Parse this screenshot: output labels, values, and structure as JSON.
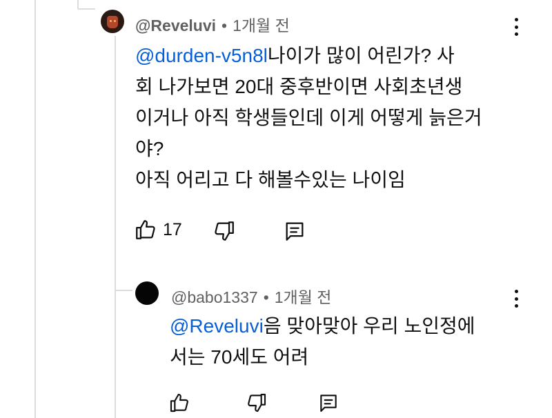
{
  "comment": {
    "author": "@Reveluvi",
    "separator": "•",
    "time": "1개월 전",
    "mention": "@durden-v5n8l",
    "text_line1": "나이가 많이 어린가? 사",
    "text_line2": "회 나가보면 20대 중후반이면 사회초년생",
    "text_line3": "이거나 아직 학생들인데 이게 어떻게 늙은거",
    "text_line4": "야?",
    "text_line5": "아직 어리고 다 해볼수있는 나이임",
    "likes": "17",
    "icons": [
      "thumbs-up-icon",
      "thumbs-down-icon",
      "reply-icon",
      "more-vert-icon"
    ]
  },
  "reply": {
    "author": "@babo1337",
    "separator": "•",
    "time": "1개월 전",
    "mention": "@Reveluvi",
    "text_line1": "음 맞아맞아 우리 노인정에",
    "text_line2": "서는 70세도 어려",
    "icons": [
      "thumbs-up-icon",
      "thumbs-down-icon",
      "reply-icon",
      "more-vert-icon"
    ]
  },
  "colors": {
    "text": "#0f0f0f",
    "meta": "#606060",
    "mention": "#065fd4",
    "thread_line": "#dcdcdc"
  }
}
